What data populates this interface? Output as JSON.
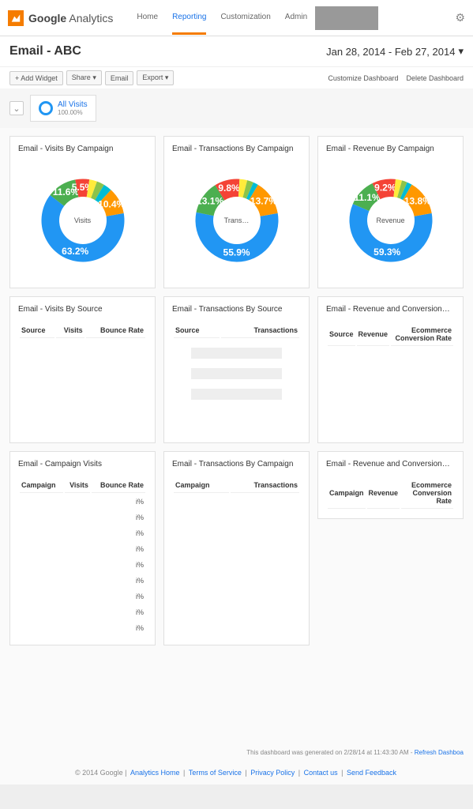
{
  "brand": {
    "google": "Google",
    "analytics": "Analytics"
  },
  "nav": {
    "home": "Home",
    "reporting": "Reporting",
    "customization": "Customization",
    "admin": "Admin"
  },
  "header": {
    "title": "Email - ABC",
    "date_range": "Jan 28, 2014 - Feb 27, 2014"
  },
  "toolbar": {
    "add_widget": "+ Add Widget",
    "share": "Share ▾",
    "email": "Email",
    "export": "Export ▾",
    "customize": "Customize Dashboard",
    "delete": "Delete Dashboard"
  },
  "segment": {
    "name": "All Visits",
    "pct": "100.00%"
  },
  "widgets": {
    "w1": {
      "title": "Email - Visits By Campaign",
      "center": "Visits"
    },
    "w2": {
      "title": "Email - Transactions By Campaign",
      "center": "Trans…"
    },
    "w3": {
      "title": "Email - Revenue By Campaign",
      "center": "Revenue"
    },
    "w4": {
      "title": "Email - Visits By Source",
      "cols": {
        "c1": "Source",
        "c2": "Visits",
        "c3": "Bounce Rate"
      }
    },
    "w5": {
      "title": "Email - Transactions By Source",
      "cols": {
        "c1": "Source",
        "c2": "Transactions"
      }
    },
    "w6": {
      "title": "Email - Revenue and Conversion…",
      "cols": {
        "c1": "Source",
        "c2": "Revenue",
        "c3": "Ecommerce Conversion Rate"
      }
    },
    "w7": {
      "title": "Email - Campaign Visits",
      "cols": {
        "c1": "Campaign",
        "c2": "Visits",
        "c3": "Bounce Rate"
      }
    },
    "w8": {
      "title": "Email - Transactions By Campaign",
      "cols": {
        "c1": "Campaign",
        "c2": "Transactions"
      }
    },
    "w9": {
      "title": "Email - Revenue and Conversion…",
      "cols": {
        "c1": "Campaign",
        "c2": "Revenue",
        "c3": "Ecommerce Conversion Rate"
      }
    }
  },
  "campaign_rows_bounce": [
    "i%",
    "i%",
    "i%",
    "i%",
    "i%",
    "i%",
    "i%",
    "i%",
    "i%"
  ],
  "footer_note": {
    "text": "This dashboard was generated on 2/28/14 at 11:43:30 AM - ",
    "refresh": "Refresh Dashboa"
  },
  "footer": {
    "copyright": "© 2014 Google",
    "links": {
      "home": "Analytics Home",
      "tos": "Terms of Service",
      "privacy": "Privacy Policy",
      "contact": "Contact us",
      "feedback": "Send Feedback"
    }
  },
  "chart_data": [
    {
      "type": "pie",
      "title": "Email - Visits By Campaign",
      "metric": "Visits",
      "slices": [
        {
          "label": "63.2%",
          "value": 63.2,
          "color": "#2196f3"
        },
        {
          "label": "11.6%",
          "value": 11.6,
          "color": "#4caf50"
        },
        {
          "label": "5.5%",
          "value": 5.5,
          "color": "#f44336"
        },
        {
          "label": "",
          "value": 3.0,
          "color": "#ffeb3b"
        },
        {
          "label": "",
          "value": 3.0,
          "color": "#8bc34a"
        },
        {
          "label": "",
          "value": 3.3,
          "color": "#00bcd4"
        },
        {
          "label": "10.4%",
          "value": 10.4,
          "color": "#ff9800"
        }
      ]
    },
    {
      "type": "pie",
      "title": "Email - Transactions By Campaign",
      "metric": "Transactions",
      "slices": [
        {
          "label": "55.9%",
          "value": 55.9,
          "color": "#2196f3"
        },
        {
          "label": "13.1%",
          "value": 13.1,
          "color": "#4caf50"
        },
        {
          "label": "9.8%",
          "value": 9.8,
          "color": "#f44336"
        },
        {
          "label": "",
          "value": 3.0,
          "color": "#ffeb3b"
        },
        {
          "label": "",
          "value": 2.5,
          "color": "#8bc34a"
        },
        {
          "label": "",
          "value": 2.0,
          "color": "#00bcd4"
        },
        {
          "label": "13.7%",
          "value": 13.7,
          "color": "#ff9800"
        }
      ]
    },
    {
      "type": "pie",
      "title": "Email - Revenue By Campaign",
      "metric": "Revenue",
      "slices": [
        {
          "label": "59.3%",
          "value": 59.3,
          "color": "#2196f3"
        },
        {
          "label": "11.1%",
          "value": 11.1,
          "color": "#4caf50"
        },
        {
          "label": "9.2%",
          "value": 9.2,
          "color": "#f44336"
        },
        {
          "label": "",
          "value": 2.5,
          "color": "#ffeb3b"
        },
        {
          "label": "",
          "value": 2.1,
          "color": "#8bc34a"
        },
        {
          "label": "",
          "value": 2.0,
          "color": "#00bcd4"
        },
        {
          "label": "13.8%",
          "value": 13.8,
          "color": "#ff9800"
        }
      ]
    }
  ]
}
